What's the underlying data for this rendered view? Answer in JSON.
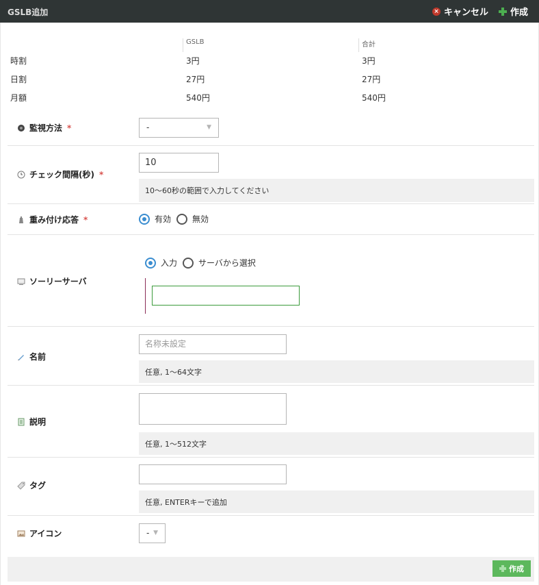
{
  "header": {
    "title": "GSLB追加",
    "cancel_label": "キャンセル",
    "create_label": "作成"
  },
  "pricing": {
    "col_gslb": "GSLB",
    "col_total": "合計",
    "rows": [
      {
        "label": "時割",
        "gslb": "3円",
        "total": "3円"
      },
      {
        "label": "日割",
        "gslb": "27円",
        "total": "27円"
      },
      {
        "label": "月額",
        "gslb": "540円",
        "total": "540円"
      }
    ]
  },
  "form": {
    "monitor": {
      "label": "監視方法",
      "required": "*",
      "value": "-"
    },
    "interval": {
      "label": "チェック間隔(秒)",
      "required": "*",
      "value": "10",
      "hint": "10～60秒の範囲で入力してください"
    },
    "weighted": {
      "label": "重み付け応答",
      "required": "*",
      "option_on": "有効",
      "option_off": "無効",
      "selected": "有効"
    },
    "sorry": {
      "label": "ソーリーサーバ",
      "option_input": "入力",
      "option_select": "サーバから選択",
      "selected": "入力",
      "value": ""
    },
    "name": {
      "label": "名前",
      "placeholder": "名称未設定",
      "hint": "任意, 1～64文字"
    },
    "description": {
      "label": "説明",
      "value": "",
      "hint": "任意, 1～512文字"
    },
    "tag": {
      "label": "タグ",
      "value": "",
      "hint": "任意, ENTERキーで追加"
    },
    "icon": {
      "label": "アイコン",
      "value": "-"
    }
  },
  "footer": {
    "create_label": "作成"
  },
  "colors": {
    "titlebar": "#2f3535",
    "accent_green": "#5cb85c",
    "required_red": "#d9534f",
    "radio_blue": "#3a8dd0"
  }
}
